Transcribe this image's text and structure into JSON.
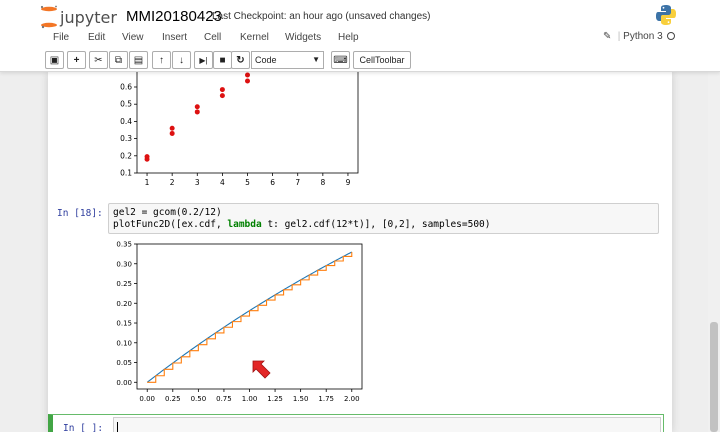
{
  "header": {
    "logo_text": "jupyter",
    "notebook_name": "MMI20180423",
    "checkpoint": "Last Checkpoint: an hour ago (unsaved changes)"
  },
  "menu": {
    "items": [
      "File",
      "Edit",
      "View",
      "Insert",
      "Cell",
      "Kernel",
      "Widgets",
      "Help"
    ],
    "kernel_name": "Python 3"
  },
  "toolbar": {
    "cell_type": "Code",
    "celltoolbar_label": "CellToolbar",
    "icons": [
      "save-icon",
      "plus-icon",
      "cut-icon",
      "copy-icon",
      "paste-icon",
      "arrow-up-icon",
      "arrow-down-icon",
      "step-forward-icon",
      "stop-icon",
      "restart-icon",
      "keyboard-icon"
    ]
  },
  "cells": {
    "cell18": {
      "prompt": "In [18]:",
      "line1": "gel2 = gcom(0.2/12)",
      "line2_a": "plotFunc2D([ex.cdf, ",
      "line2_kw": "lambda",
      "line2_b": " t: gel2.cdf(12*t)], [0,2], samples=500)"
    },
    "new_cell": {
      "prompt": "In [ ]:",
      "value": ""
    }
  },
  "chart_data": [
    {
      "type": "scatter",
      "title": "",
      "xlabel": "",
      "ylabel": "",
      "xlim": [
        0.6,
        9.4
      ],
      "ylim": [
        0.1,
        0.7
      ],
      "xticks": [
        1,
        2,
        3,
        4,
        5,
        6,
        7,
        8,
        9
      ],
      "yticks": [
        0.1,
        0.2,
        0.3,
        0.4,
        0.5,
        0.6
      ],
      "series": [
        {
          "color": "#dd1111",
          "points": [
            [
              1,
              0.18
            ],
            [
              1,
              0.195
            ],
            [
              2,
              0.33
            ],
            [
              2,
              0.36
            ],
            [
              3,
              0.455
            ],
            [
              3,
              0.485
            ],
            [
              4,
              0.55
            ],
            [
              4,
              0.585
            ],
            [
              5,
              0.635
            ],
            [
              5,
              0.67
            ]
          ]
        }
      ],
      "grid": false
    },
    {
      "type": "line",
      "title": "",
      "xlabel": "",
      "ylabel": "",
      "xlim": [
        -0.1,
        2.1
      ],
      "ylim": [
        -0.017,
        0.35
      ],
      "xticks": [
        0.0,
        0.25,
        0.5,
        0.75,
        1.0,
        1.25,
        1.5,
        1.75,
        2.0
      ],
      "xtick_labels": [
        "0.00",
        "0.25",
        "0.50",
        "0.75",
        "1.00",
        "1.25",
        "1.50",
        "1.75",
        "2.00"
      ],
      "yticks": [
        0.0,
        0.05,
        0.1,
        0.15,
        0.2,
        0.25,
        0.3,
        0.35
      ],
      "ytick_labels": [
        "0.00",
        "0.05",
        "0.10",
        "0.15",
        "0.20",
        "0.25",
        "0.30",
        "0.35"
      ],
      "series": [
        {
          "color": "#1f77b4",
          "style": "smooth",
          "x": [
            0,
            2
          ],
          "rate": 0.2
        },
        {
          "color": "#ff7f0e",
          "style": "step",
          "steps": 24,
          "x": [
            0,
            2
          ]
        }
      ],
      "grid": false
    }
  ],
  "colors": {
    "accent": "#f37626",
    "prompt": "#303f9f",
    "selected_cell": "#42a545",
    "cursor_overlay": "#e32626"
  }
}
